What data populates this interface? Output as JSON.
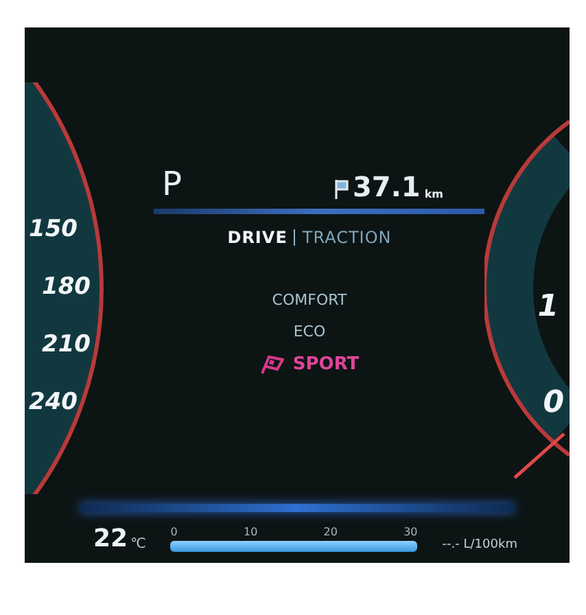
{
  "speedometer": {
    "ticks": [
      "150",
      "180",
      "210",
      "240"
    ]
  },
  "gear": "P",
  "trip": {
    "value": "37.1",
    "unit": "km"
  },
  "mode_tabs": [
    {
      "label": "DRIVE",
      "selected": true
    },
    {
      "label": "TRACTION",
      "selected": false
    }
  ],
  "drive_modes": [
    {
      "label": "COMFORT",
      "selected": false
    },
    {
      "label": "ECO",
      "selected": false
    },
    {
      "label": "SPORT",
      "selected": true
    }
  ],
  "right_gauge": {
    "ticks": [
      "1",
      "0"
    ]
  },
  "temperature": {
    "value": "22",
    "unit": "℃"
  },
  "consumption_bar": {
    "ticks": [
      "0",
      "10",
      "20",
      "30"
    ],
    "level": 1
  },
  "consumption": "--.- L/100km"
}
